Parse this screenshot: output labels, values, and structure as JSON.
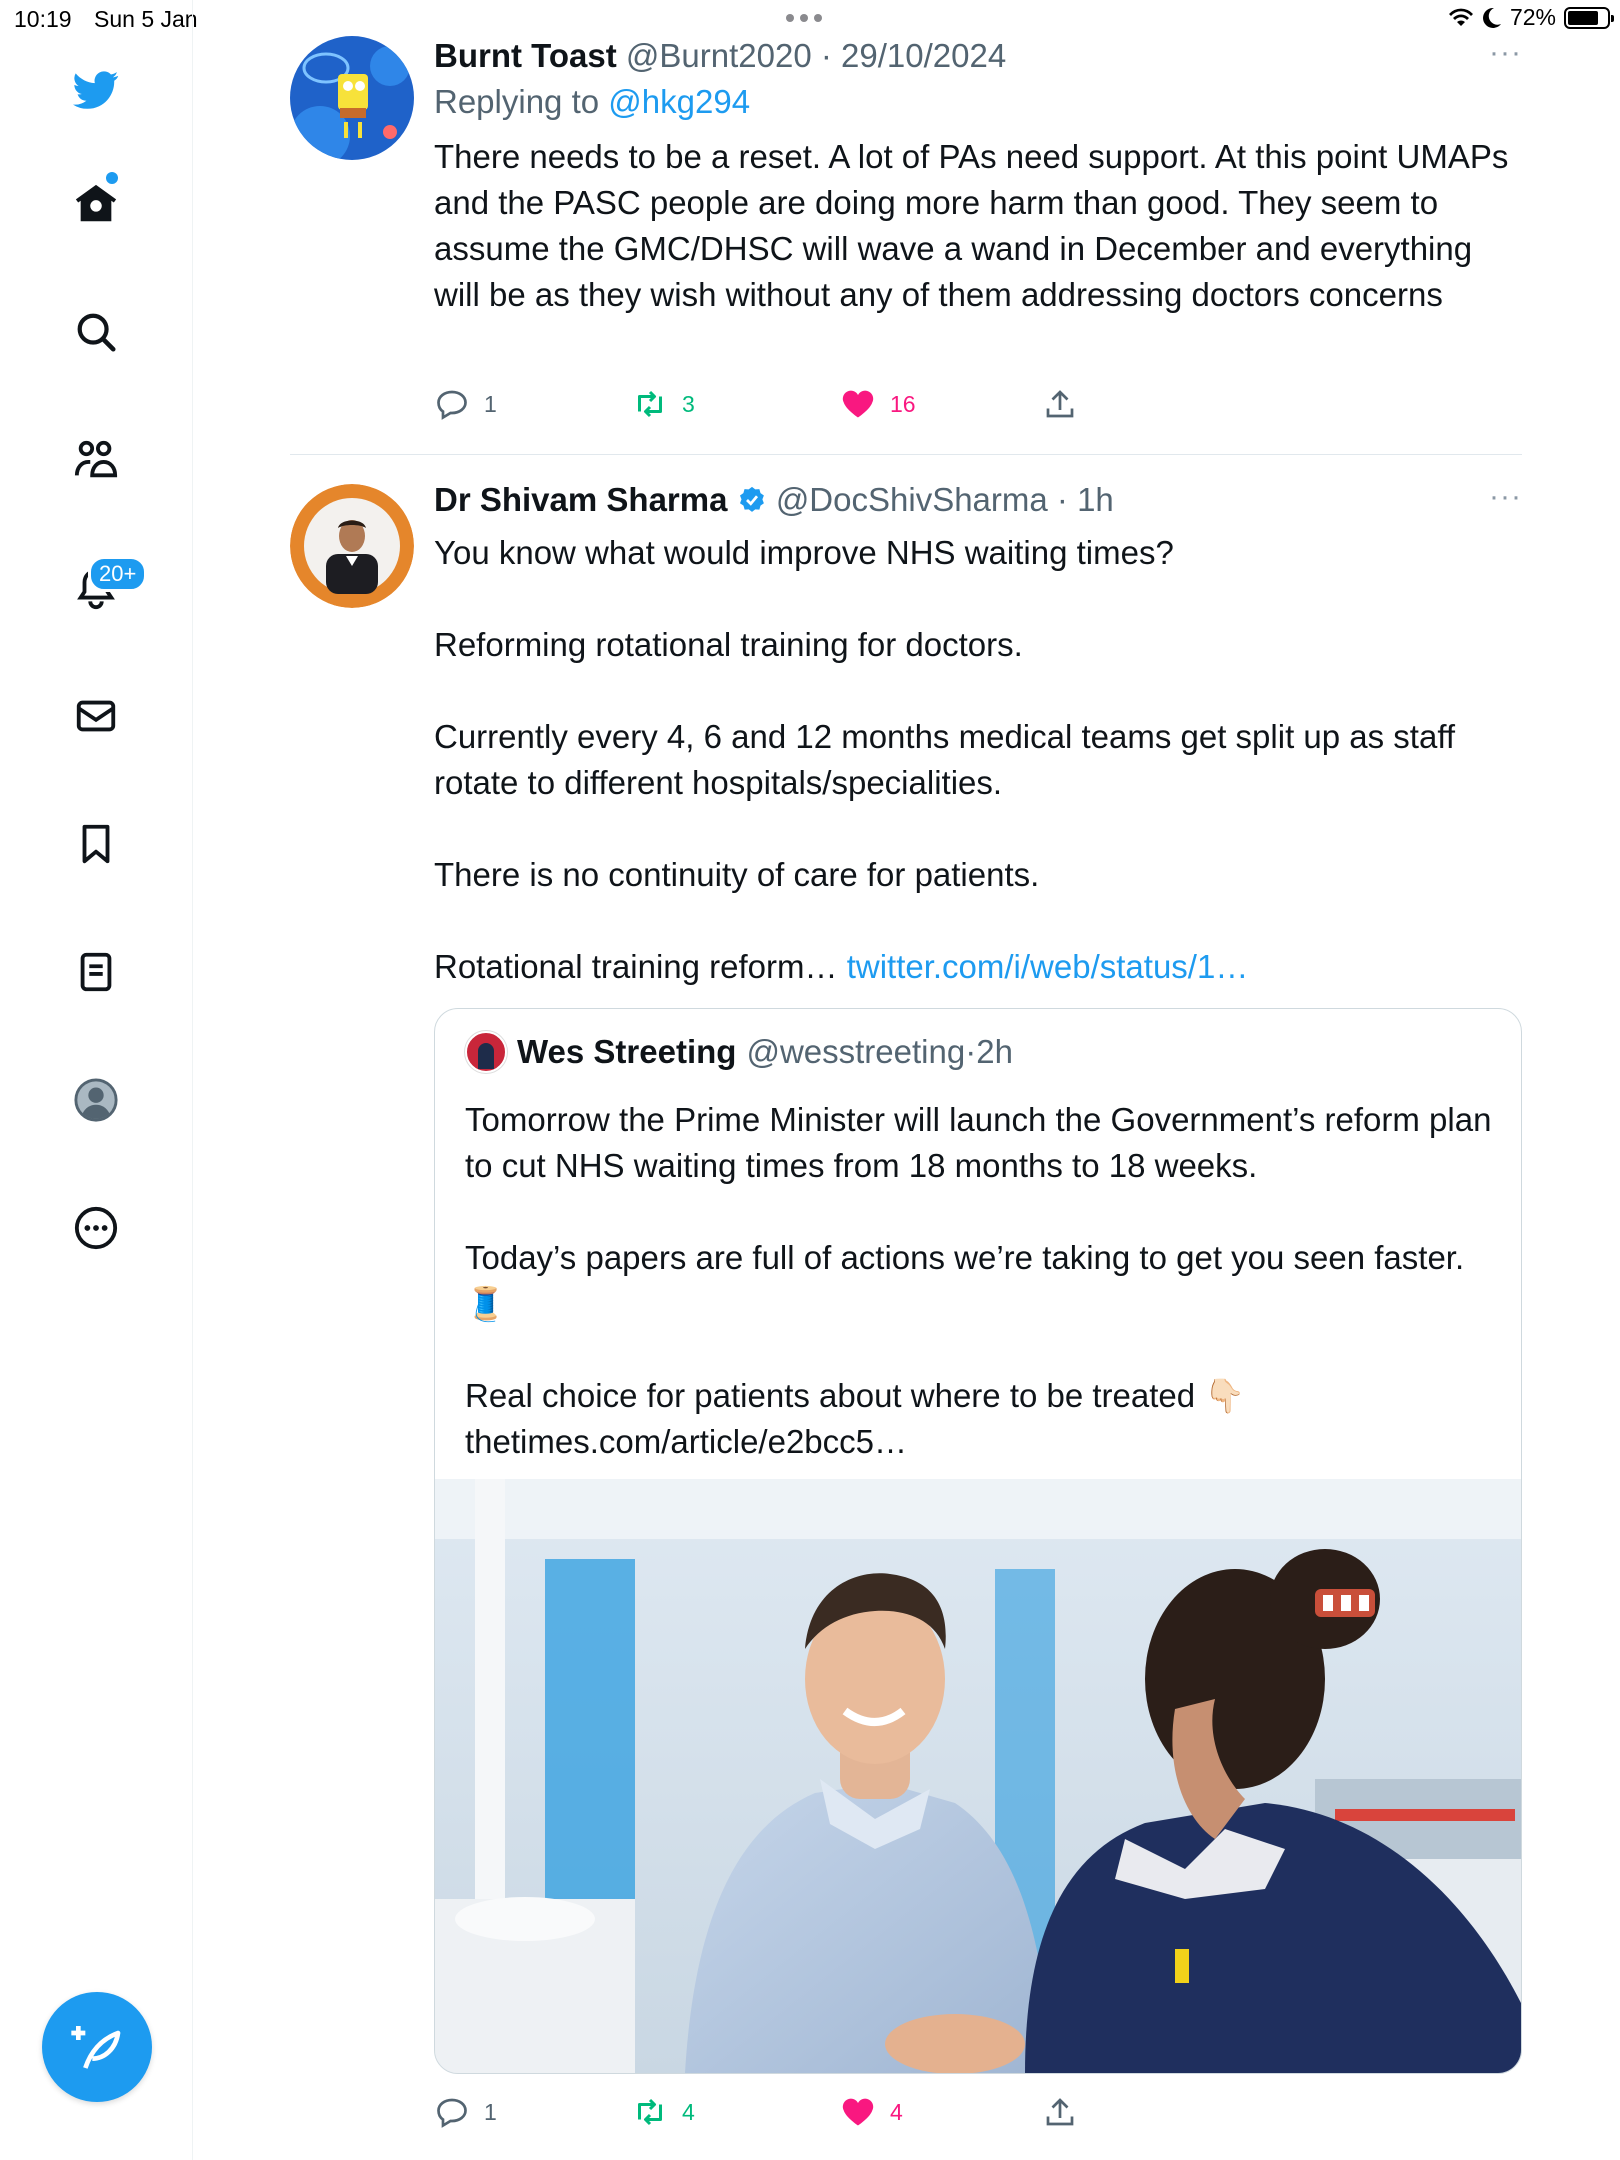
{
  "status_bar": {
    "time": "10:19",
    "date": "Sun 5 Jan",
    "battery": "72%",
    "battery_level": 0.72
  },
  "sidebar": {
    "items": [
      {
        "icon": "twitter-bird-icon"
      },
      {
        "icon": "home-icon"
      },
      {
        "icon": "search-icon"
      },
      {
        "icon": "communities-icon"
      },
      {
        "icon": "notifications-bell-icon",
        "badge": "20+"
      },
      {
        "icon": "messages-envelope-icon"
      },
      {
        "icon": "bookmark-icon"
      },
      {
        "icon": "lists-icon"
      },
      {
        "icon": "profile-avatar-icon"
      },
      {
        "icon": "more-circle-icon"
      }
    ],
    "compose_icon": "compose-tweet-icon"
  },
  "tweets": [
    {
      "name": "Burnt Toast",
      "handle": "@Burnt2020",
      "time": "29/10/2024",
      "replying_prefix": "Replying to",
      "replying_to": "@hkg294",
      "text": "There needs to be a reset. A lot of PAs need support. At this point UMAPs and the PASC people are doing more harm than good. They seem to assume the GMC/DHSC will wave a wand in December and everything will be as they wish without any of them addressing doctors concerns",
      "replies": "1",
      "retweets": "3",
      "likes": "16"
    },
    {
      "name": "Dr Shivam Sharma",
      "verified": true,
      "handle": "@DocShivSharma",
      "time": "1h",
      "text": "You know what would improve NHS waiting times?\n\nReforming rotational training for doctors.\n\nCurrently every 4, 6 and 12 months medical teams get split up as staff rotate to different hospitals/specialities.\n\nThere is no continuity of care for patients.\n\nRotational training reform… ",
      "link": "twitter.com/i/web/status/1…",
      "quote": {
        "name": "Wes Streeting",
        "handle": "@wesstreeting",
        "time": "2h",
        "text": "Tomorrow the Prime Minister will launch the Government’s reform plan to cut NHS waiting times from 18 months to 18 weeks.\n\nToday’s papers are full of actions we’re taking to get you seen faster. 🧵\n\nReal choice for patients about where to be treated 👇🏻\nthetimes.com/article/e2bcc5…"
      },
      "replies": "1",
      "retweets": "4",
      "likes": "4"
    }
  ],
  "colors": {
    "accent": "#1d9bf0",
    "retweet": "#00ba7c",
    "like": "#f91880",
    "secondary_text": "#536471"
  }
}
